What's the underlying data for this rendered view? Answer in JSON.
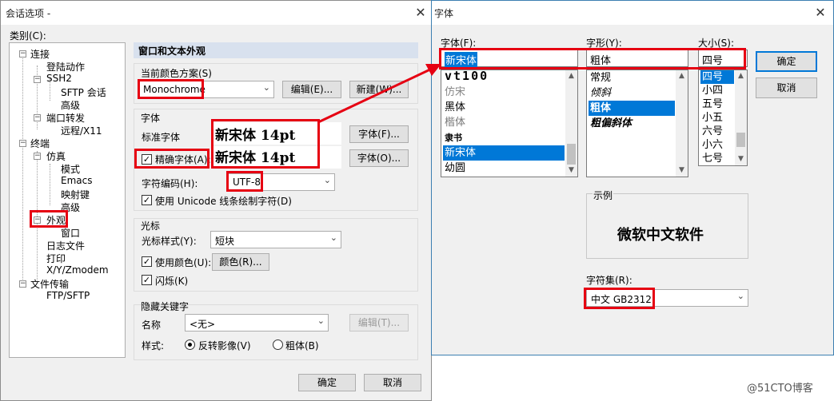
{
  "session_dialog": {
    "title": "会话选项 -",
    "category_label": "类别(C):",
    "tree": [
      "连接",
      "登陆动作",
      "SSH2",
      "SFTP 会话",
      "高级",
      "端口转发",
      "远程/X11",
      "终端",
      "仿真",
      "模式",
      "Emacs",
      "映射键",
      "高级",
      "外观",
      "窗口",
      "日志文件",
      "打印",
      "X/Y/Zmodem",
      "文件传输",
      "FTP/SFTP"
    ],
    "section_title": "窗口和文本外观",
    "color_scheme_label": "当前颜色方案(S)",
    "color_scheme_value": "Monochrome",
    "edit_button": "编辑(E)...",
    "new_button": "新建(W)...",
    "font_group": "字体",
    "standard_font_label": "标准字体",
    "precise_font_label": "精确字体(A):",
    "font_preview_1": "新宋体 14pt",
    "font_preview_2": "新宋体 14pt",
    "font_button_f": "字体(F)...",
    "font_button_o": "字体(O)...",
    "encoding_label": "字符编码(H):",
    "encoding_value": "UTF-8",
    "unicode_line_label": "使用 Unicode 线条绘制字符(D)",
    "cursor_group": "光标",
    "cursor_style_label": "光标样式(Y):",
    "cursor_style_value": "短块",
    "use_color_label": "使用颜色(U):",
    "color_button": "颜色(R)...",
    "blink_label": "闪烁(K)",
    "hidden_keyword_group": "隐藏关键字",
    "name_label": "名称",
    "name_value": "<无>",
    "edit_t_button": "编辑(T)...",
    "style_label": "样式:",
    "reverse_label": "反转影像(V)",
    "bold_label": "粗体(B)",
    "ok_button": "确定",
    "cancel_button": "取消"
  },
  "font_dialog": {
    "title": "字体",
    "font_label": "字体(F):",
    "style_label": "字形(Y):",
    "size_label": "大小(S):",
    "font_value": "新宋体",
    "style_value": "粗体",
    "size_value": "四号",
    "fonts": [
      "vt100",
      "仿宋",
      "黑体",
      "楷体",
      "隶书",
      "新宋体",
      "幼圆"
    ],
    "styles": [
      "常规",
      "倾斜",
      "粗体",
      "粗偏斜体"
    ],
    "sizes": [
      "四号",
      "小四",
      "五号",
      "小五",
      "六号",
      "小六",
      "七号"
    ],
    "ok_button": "确定",
    "cancel_button": "取消",
    "sample_label": "示例",
    "sample_text": "微软中文软件",
    "charset_label": "字符集(R):",
    "charset_value": "中文 GB2312"
  },
  "watermark": "@51CTO博客",
  "colors": {
    "highlight_red": "#e60012",
    "selection_blue": "#0078d7"
  }
}
